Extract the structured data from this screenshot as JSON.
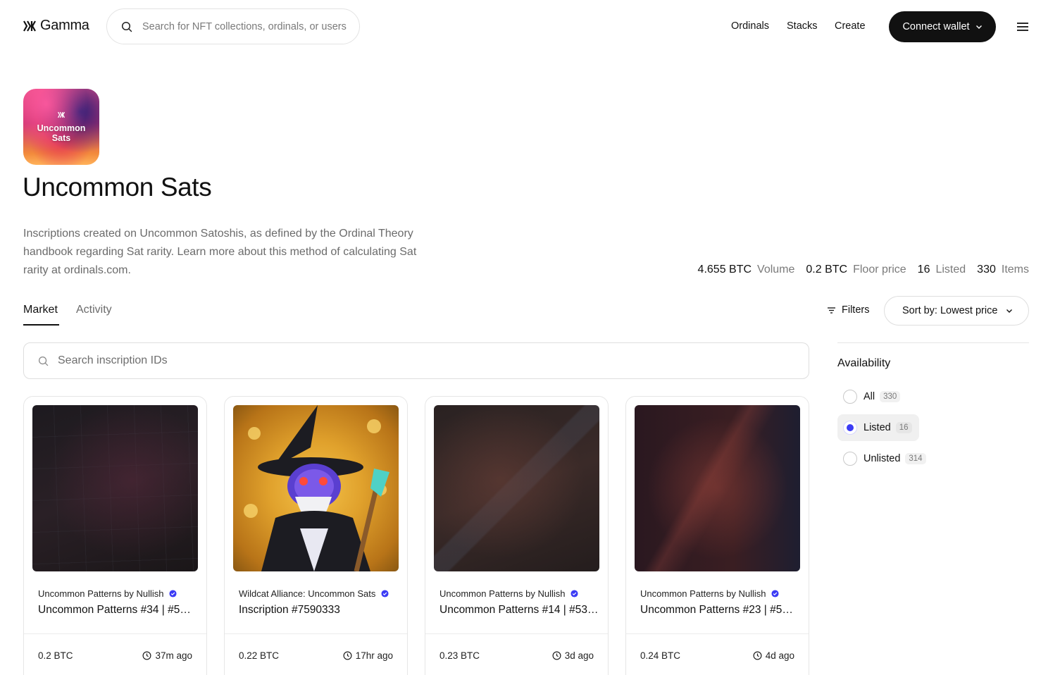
{
  "header": {
    "logo_text": "Gamma",
    "search_placeholder": "Search for NFT collections, ordinals, or users",
    "nav": [
      "Ordinals",
      "Stacks",
      "Create"
    ],
    "connect_wallet": "Connect wallet"
  },
  "collection": {
    "image_line1": "Uncommon",
    "image_line2": "Sats",
    "title": "Uncommon Sats",
    "description": "Inscriptions created on Uncommon Satoshis, as defined by the Ordinal Theory handbook regarding Sat rarity. Learn more about this method of calculating Sat rarity at ordinals.com.",
    "stats": [
      {
        "value": "4.655 BTC",
        "label": "Volume"
      },
      {
        "value": "0.2 BTC",
        "label": "Floor price"
      },
      {
        "value": "16",
        "label": "Listed"
      },
      {
        "value": "330",
        "label": "Items"
      }
    ]
  },
  "tabs": {
    "market": "Market",
    "activity": "Activity",
    "active": "Market"
  },
  "toolbar": {
    "filters": "Filters",
    "sort": "Sort by: Lowest price",
    "search_placeholder": "Search inscription IDs"
  },
  "availability": {
    "title": "Availability",
    "options": [
      {
        "label": "All",
        "count": "330",
        "selected": false
      },
      {
        "label": "Listed",
        "count": "16",
        "selected": true
      },
      {
        "label": "Unlisted",
        "count": "314",
        "selected": false
      }
    ]
  },
  "cards": [
    {
      "collection": "Uncommon Patterns by Nullish",
      "name": "Uncommon Patterns #34 | #5…",
      "price": "0.2 BTC",
      "time": "37m ago"
    },
    {
      "collection": "Wildcat Alliance: Uncommon Sats",
      "name": "Inscription #7590333",
      "price": "0.22 BTC",
      "time": "17hr ago"
    },
    {
      "collection": "Uncommon Patterns by Nullish",
      "name": "Uncommon Patterns #14 | #53…",
      "price": "0.23 BTC",
      "time": "3d ago"
    },
    {
      "collection": "Uncommon Patterns by Nullish",
      "name": "Uncommon Patterns #23 | #5…",
      "price": "0.24 BTC",
      "time": "4d ago"
    }
  ],
  "colors": {
    "accent": "#3b3bf5",
    "verified": "#3b3bf5",
    "dark_button": "#111111"
  }
}
